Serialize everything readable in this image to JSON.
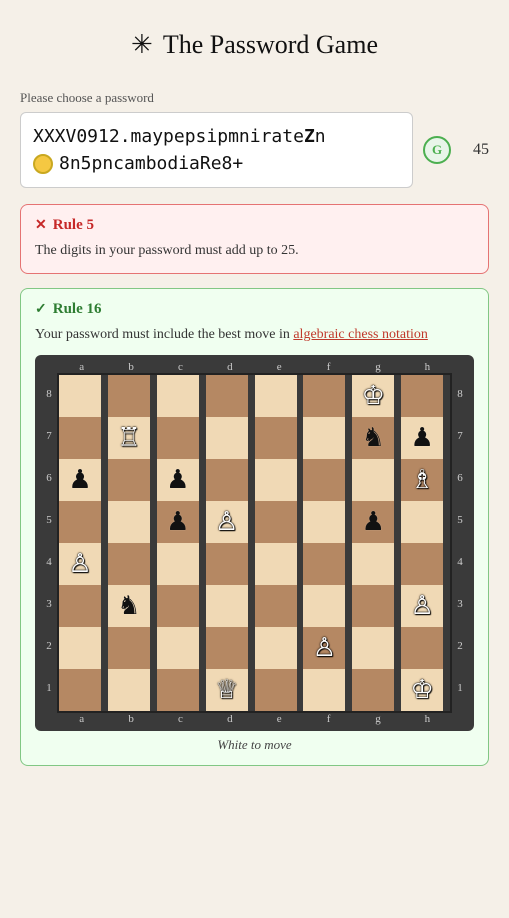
{
  "page": {
    "title": "The Password Game",
    "star": "✳"
  },
  "password_label": "Please choose a password",
  "password": {
    "line1": "XXXV0912.maypepsipmnirate Zn",
    "line2_text": "8n5pncambodiaRe8+",
    "char_count": "45"
  },
  "grammarly": "G",
  "rules": {
    "rule5": {
      "id": "Rule 5",
      "status": "fail",
      "icon_fail": "✕",
      "text": "The digits in your password must add up to 25."
    },
    "rule16": {
      "id": "Rule 16",
      "status": "pass",
      "icon_pass": "✓",
      "text_before": "Your password must include the best move in ",
      "link_text": "algebraic chess notation",
      "caption": "White to move"
    }
  },
  "chess": {
    "files": [
      "a",
      "b",
      "c",
      "d",
      "e",
      "f",
      "g",
      "h"
    ],
    "ranks": [
      "8",
      "7",
      "6",
      "5",
      "4",
      "3",
      "2",
      "1"
    ],
    "position": {
      "8": [
        "",
        "",
        "",
        "",
        "",
        "",
        "♔",
        ""
      ],
      "7": [
        "",
        "♖",
        "",
        "",
        "",
        "",
        "♞",
        "♟"
      ],
      "6": [
        "♟",
        "",
        "♟",
        "",
        "",
        "",
        "",
        "♗"
      ],
      "5": [
        "",
        "",
        "♟",
        "♙",
        "",
        "",
        "♟",
        ""
      ],
      "4": [
        "♙",
        "",
        "",
        "",
        "",
        "",
        "",
        ""
      ],
      "3": [
        "",
        "♞",
        "",
        "",
        "",
        "",
        "",
        "♙"
      ],
      "2": [
        "",
        "",
        "",
        "",
        "",
        "♙",
        "",
        ""
      ],
      "1": [
        "",
        "",
        "",
        "♕",
        "",
        "",
        "",
        "♔"
      ]
    }
  }
}
